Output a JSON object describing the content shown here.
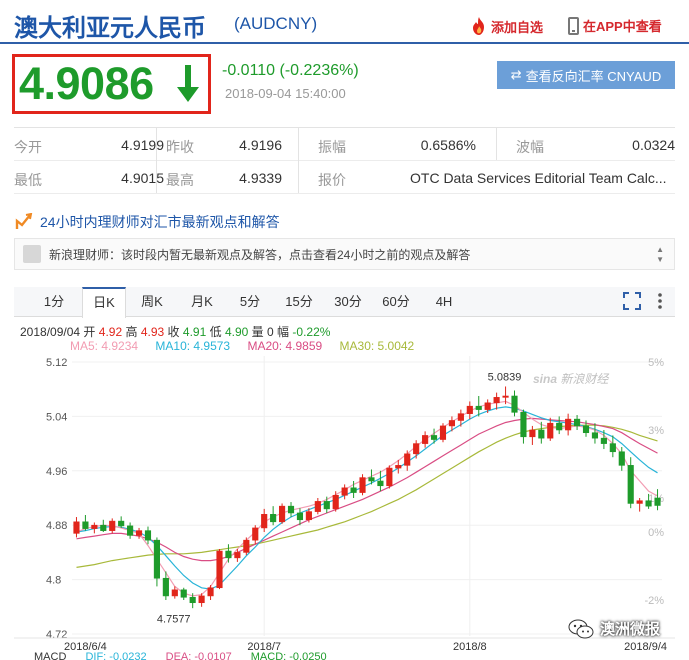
{
  "header": {
    "title": "澳大利亚元人民币",
    "code": "(AUDCNY)",
    "fav_label": "添加自选",
    "app_label": "在APP中查看"
  },
  "quote": {
    "price": "4.9086",
    "change": "-0.0110 (-0.2236%)",
    "time": "2018-09-04 15:40:00",
    "reverse_label": "查看反向汇率 CNYAUD",
    "direction": "down"
  },
  "stats": {
    "open_label": "今开",
    "open": "4.9199",
    "prev_label": "昨收",
    "prev": "4.9196",
    "amp_label": "振幅",
    "amp": "0.6586%",
    "wave_label": "波幅",
    "wave": "0.0324",
    "low_label": "最低",
    "low": "4.9015",
    "high_label": "最高",
    "high": "4.9339",
    "source_label": "报价",
    "source": "OTC Data Services Editorial Team Calc..."
  },
  "expert": {
    "head": "24小时内理财师对汇市最新观点和解答",
    "message": "新浪理财师：该时段内暂无最新观点及解答，点击查看24小时之前的观点及解答"
  },
  "tabs": [
    "1分",
    "日K",
    "周K",
    "月K",
    "5分",
    "15分",
    "30分",
    "60分",
    "4H"
  ],
  "active_tab": "日K",
  "candle_info": {
    "date": "2018/09/04",
    "open_label": "开",
    "open": "4.92",
    "high_label": "高",
    "high": "4.93",
    "close_label": "收",
    "close": "4.91",
    "low_label": "低",
    "low": "4.90",
    "vol_label": "量",
    "vol": "0",
    "amp_label": "幅",
    "amp": "-0.22%"
  },
  "ma_info": {
    "ma5": "MA5: 4.9234",
    "ma10": "MA10: 4.9573",
    "ma20": "MA20: 4.9859",
    "ma30": "MA30: 5.0042"
  },
  "macd_info": {
    "macd_label": "MACD",
    "dif": "DIF: -0.0232",
    "dea": "DEA: -0.0107",
    "macd": "MACD: -0.0250"
  },
  "watermarks": {
    "sina": "新浪财经",
    "wechat": "澳洲微报"
  },
  "colors": {
    "up": "#e1251b",
    "down": "#1e9b2b",
    "ma5": "#f29cb2",
    "ma10": "#28b4d8",
    "ma20": "#d94d84",
    "ma30": "#a8b93a",
    "brand": "#1e56a8"
  },
  "chart_data": {
    "type": "candlestick",
    "y_ticks": [
      "5.12",
      "5.04",
      "4.96",
      "4.88",
      "4.8",
      "4.72"
    ],
    "y_tick_values": [
      5.12,
      5.04,
      4.96,
      4.88,
      4.8,
      4.72
    ],
    "pct_ticks": [
      "5%",
      "3%",
      "1%",
      "0%",
      "-2%"
    ],
    "pct_values": [
      5,
      3,
      1,
      0,
      -2
    ],
    "ylim": [
      4.72,
      5.12
    ],
    "pct_ylim": [
      -3,
      5
    ],
    "x_labels": [
      "2018/6/4",
      "2018/7",
      "2018/8",
      "2018/9/4"
    ],
    "x_label_index": [
      1,
      21,
      44,
      65
    ],
    "annotations": [
      {
        "text": "5.0839",
        "index": 49,
        "value": 5.0839
      },
      {
        "text": "4.7577",
        "index": 12,
        "value": 4.7577
      }
    ],
    "candles": [
      [
        4.868,
        4.892,
        4.862,
        4.885
      ],
      [
        4.885,
        4.895,
        4.872,
        4.875
      ],
      [
        4.875,
        4.884,
        4.868,
        4.88
      ],
      [
        4.88,
        4.888,
        4.87,
        4.872
      ],
      [
        4.872,
        4.89,
        4.868,
        4.886
      ],
      [
        4.886,
        4.893,
        4.876,
        4.879
      ],
      [
        4.879,
        4.884,
        4.86,
        4.865
      ],
      [
        4.865,
        4.876,
        4.86,
        4.872
      ],
      [
        4.872,
        4.878,
        4.852,
        4.858
      ],
      [
        4.858,
        4.862,
        4.79,
        4.802
      ],
      [
        4.802,
        4.812,
        4.77,
        4.776
      ],
      [
        4.776,
        4.79,
        4.772,
        4.785
      ],
      [
        4.785,
        4.788,
        4.77,
        4.774
      ],
      [
        4.774,
        4.78,
        4.758,
        4.766
      ],
      [
        4.766,
        4.78,
        4.76,
        4.776
      ],
      [
        4.776,
        4.792,
        4.77,
        4.788
      ],
      [
        4.788,
        4.845,
        4.786,
        4.842
      ],
      [
        4.842,
        4.852,
        4.825,
        4.832
      ],
      [
        4.832,
        4.845,
        4.826,
        4.84
      ],
      [
        4.84,
        4.862,
        4.836,
        4.858
      ],
      [
        4.858,
        4.88,
        4.852,
        4.876
      ],
      [
        4.876,
        4.904,
        4.87,
        4.896
      ],
      [
        4.896,
        4.908,
        4.88,
        4.885
      ],
      [
        4.885,
        4.912,
        4.882,
        4.908
      ],
      [
        4.908,
        4.914,
        4.892,
        4.898
      ],
      [
        4.898,
        4.905,
        4.88,
        4.888
      ],
      [
        4.888,
        4.905,
        4.884,
        4.9
      ],
      [
        4.9,
        4.92,
        4.896,
        4.915
      ],
      [
        4.915,
        4.922,
        4.898,
        4.904
      ],
      [
        4.904,
        4.93,
        4.9,
        4.924
      ],
      [
        4.924,
        4.94,
        4.918,
        4.935
      ],
      [
        4.935,
        4.945,
        4.92,
        4.928
      ],
      [
        4.928,
        4.955,
        4.924,
        4.95
      ],
      [
        4.95,
        4.962,
        4.94,
        4.945
      ],
      [
        4.945,
        4.96,
        4.93,
        4.938
      ],
      [
        4.938,
        4.968,
        4.934,
        4.964
      ],
      [
        4.964,
        4.976,
        4.956,
        4.968
      ],
      [
        4.968,
        4.99,
        4.96,
        4.985
      ],
      [
        4.985,
        5.005,
        4.978,
        5.0
      ],
      [
        5.0,
        5.018,
        4.994,
        5.012
      ],
      [
        5.012,
        5.022,
        5.0,
        5.006
      ],
      [
        5.006,
        5.03,
        5.002,
        5.026
      ],
      [
        5.026,
        5.04,
        5.018,
        5.034
      ],
      [
        5.034,
        5.05,
        5.025,
        5.044
      ],
      [
        5.044,
        5.062,
        5.036,
        5.055
      ],
      [
        5.055,
        5.07,
        5.04,
        5.05
      ],
      [
        5.05,
        5.065,
        5.045,
        5.06
      ],
      [
        5.06,
        5.075,
        5.05,
        5.068
      ],
      [
        5.068,
        5.084,
        5.058,
        5.07
      ],
      [
        5.07,
        5.078,
        5.04,
        5.046
      ],
      [
        5.046,
        5.05,
        5.0,
        5.01
      ],
      [
        5.01,
        5.026,
        4.998,
        5.02
      ],
      [
        5.02,
        5.032,
        5.0,
        5.008
      ],
      [
        5.008,
        5.038,
        5.004,
        5.03
      ],
      [
        5.03,
        5.04,
        5.014,
        5.02
      ],
      [
        5.02,
        5.044,
        5.012,
        5.036
      ],
      [
        5.036,
        5.042,
        5.02,
        5.026
      ],
      [
        5.026,
        5.034,
        5.01,
        5.016
      ],
      [
        5.016,
        5.03,
        5.0,
        5.008
      ],
      [
        5.008,
        5.02,
        4.992,
        5.0
      ],
      [
        5.0,
        5.012,
        4.98,
        4.988
      ],
      [
        4.988,
        4.995,
        4.96,
        4.968
      ],
      [
        4.968,
        4.98,
        4.905,
        4.912
      ],
      [
        4.912,
        4.92,
        4.9,
        4.916
      ],
      [
        4.916,
        4.926,
        4.904,
        4.908
      ],
      [
        4.92,
        4.933,
        4.902,
        4.909
      ]
    ],
    "ma5": [
      4.87,
      4.875,
      4.878,
      4.88,
      4.879,
      4.876,
      4.872,
      4.868,
      4.85,
      4.83,
      4.81,
      4.79,
      4.78,
      4.776,
      4.778,
      4.79,
      4.81,
      4.83,
      4.845,
      4.858,
      4.87,
      4.885,
      4.892,
      4.898,
      4.902,
      4.905,
      4.908,
      4.912,
      4.918,
      4.925,
      4.932,
      4.94,
      4.946,
      4.952,
      4.958,
      4.966,
      4.975,
      4.985,
      4.996,
      5.006,
      5.015,
      5.024,
      5.032,
      5.04,
      5.048,
      5.054,
      5.058,
      5.06,
      5.062,
      5.056,
      5.046,
      5.036,
      5.028,
      5.024,
      5.022,
      5.024,
      5.026,
      5.024,
      5.02,
      5.012,
      5.0,
      4.985,
      4.96,
      4.945,
      4.93,
      4.923
    ],
    "ma10": [
      4.87,
      4.872,
      4.875,
      4.877,
      4.878,
      4.877,
      4.874,
      4.87,
      4.862,
      4.85,
      4.835,
      4.82,
      4.806,
      4.795,
      4.788,
      4.786,
      4.792,
      4.806,
      4.82,
      4.835,
      4.848,
      4.862,
      4.874,
      4.884,
      4.892,
      4.898,
      4.903,
      4.908,
      4.913,
      4.918,
      4.924,
      4.93,
      4.936,
      4.942,
      4.949,
      4.956,
      4.964,
      4.973,
      4.982,
      4.992,
      5.002,
      5.012,
      5.02,
      5.028,
      5.036,
      5.043,
      5.048,
      5.052,
      5.054,
      5.052,
      5.048,
      5.043,
      5.038,
      5.034,
      5.032,
      5.03,
      5.028,
      5.025,
      5.021,
      5.016,
      5.01,
      5.0,
      4.988,
      4.976,
      4.965,
      4.957
    ],
    "ma20": [
      4.86,
      4.862,
      4.864,
      4.866,
      4.868,
      4.868,
      4.866,
      4.864,
      4.86,
      4.855,
      4.848,
      4.84,
      4.834,
      4.83,
      4.828,
      4.828,
      4.83,
      4.834,
      4.84,
      4.846,
      4.852,
      4.858,
      4.864,
      4.87,
      4.876,
      4.882,
      4.888,
      4.893,
      4.898,
      4.903,
      4.908,
      4.913,
      4.918,
      4.924,
      4.93,
      4.936,
      4.943,
      4.95,
      4.958,
      4.966,
      4.974,
      4.982,
      4.99,
      4.998,
      5.006,
      5.014,
      5.02,
      5.026,
      5.031,
      5.034,
      5.036,
      5.037,
      5.036,
      5.035,
      5.034,
      5.033,
      5.032,
      5.03,
      5.028,
      5.025,
      5.022,
      5.016,
      5.008,
      5.0,
      4.993,
      4.986
    ],
    "ma30": [
      4.818,
      4.82,
      4.822,
      4.825,
      4.828,
      4.83,
      4.832,
      4.834,
      4.836,
      4.837,
      4.838,
      4.838,
      4.838,
      4.839,
      4.84,
      4.842,
      4.844,
      4.846,
      4.848,
      4.85,
      4.852,
      4.855,
      4.858,
      4.861,
      4.864,
      4.867,
      4.87,
      4.873,
      4.877,
      4.881,
      4.885,
      4.89,
      4.895,
      4.9,
      4.906,
      4.912,
      4.918,
      4.925,
      4.932,
      4.94,
      4.948,
      4.956,
      4.964,
      4.972,
      4.98,
      4.988,
      4.995,
      5.002,
      5.008,
      5.013,
      5.017,
      5.02,
      5.022,
      5.024,
      5.025,
      5.026,
      5.027,
      5.027,
      5.027,
      5.026,
      5.024,
      5.021,
      5.017,
      5.012,
      5.008,
      5.004
    ]
  }
}
